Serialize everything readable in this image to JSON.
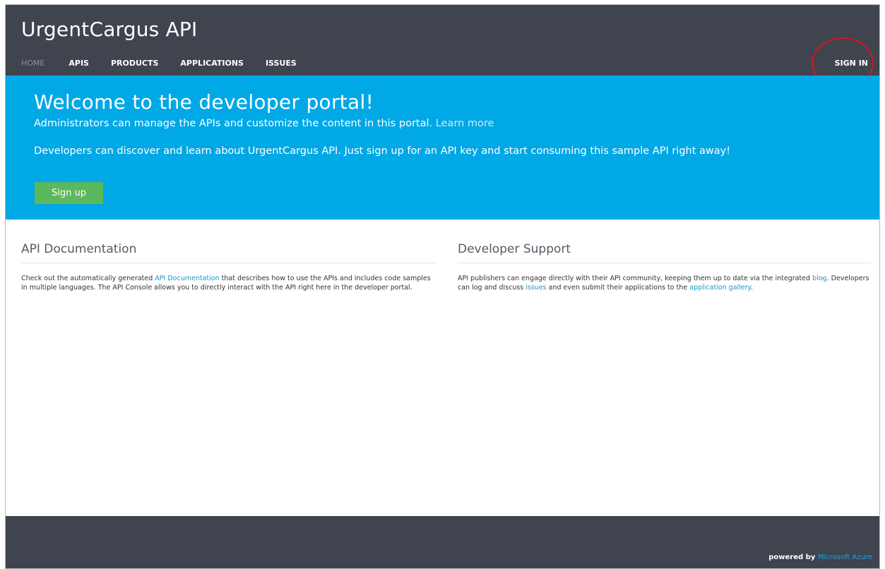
{
  "header": {
    "title": "UrgentCargus API",
    "nav": [
      {
        "label": "HOME"
      },
      {
        "label": "APIS"
      },
      {
        "label": "PRODUCTS"
      },
      {
        "label": "APPLICATIONS"
      },
      {
        "label": "ISSUES"
      }
    ],
    "signin_label": "SIGN IN"
  },
  "hero": {
    "title": "Welcome to the developer portal!",
    "line1_text": "Administrators can manage the APIs and customize the content in this portal. ",
    "line1_link": "Learn more",
    "line2": "Developers can discover and learn about UrgentCargus API. Just sign up for an API key and start consuming this sample API right away!",
    "signup_label": "Sign up"
  },
  "api_docs": {
    "heading": "API Documentation",
    "text_1": "Check out the automatically generated ",
    "link_1": "API Documentation",
    "text_2": " that describes how to use the APIs and includes code samples in multiple languages. The API Console allows you to directly interact with the API right here in the developer portal."
  },
  "dev_support": {
    "heading": "Developer Support",
    "text_1": "API publishers can engage directly with their API community, keeping them up to date via the integrated ",
    "link_blog": "blog",
    "text_2": ". Developers can log and discuss ",
    "link_issues": "issues",
    "text_3": " and even submit their applications to the ",
    "link_gallery": "application gallery",
    "text_4": "."
  },
  "footer": {
    "powered_by": "powered by ",
    "brand": "Microsoft Azure"
  },
  "colors": {
    "header_bg": "#3f444f",
    "hero_bg": "#00a8e6",
    "signup_green": "#5cb85c",
    "link_blue": "#1d95cf",
    "annotation_red": "#d8141b"
  }
}
